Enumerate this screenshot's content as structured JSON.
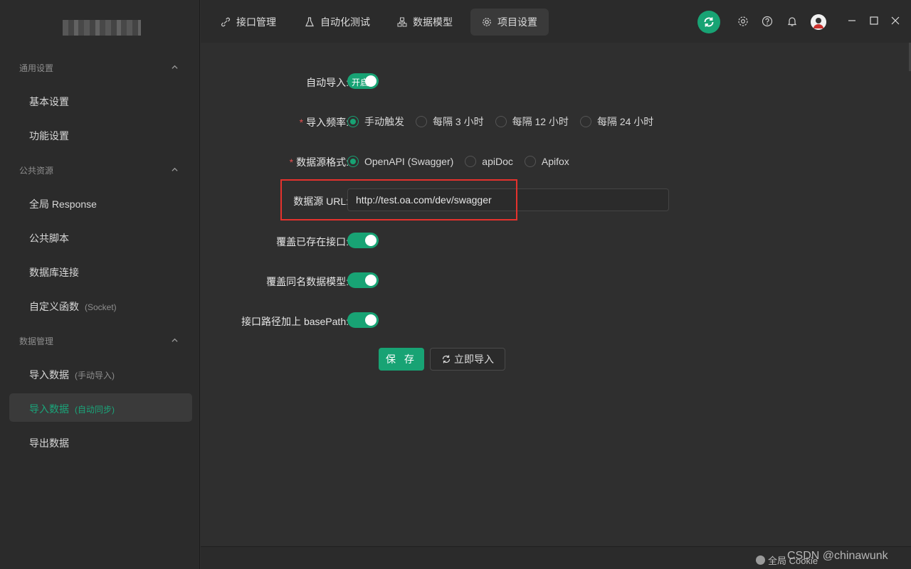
{
  "sidebar": {
    "sections": [
      {
        "title": "通用设置",
        "items": [
          {
            "label": "基本设置",
            "sub": ""
          },
          {
            "label": "功能设置",
            "sub": ""
          }
        ]
      },
      {
        "title": "公共资源",
        "items": [
          {
            "label": "全局 Response",
            "sub": ""
          },
          {
            "label": "公共脚本",
            "sub": ""
          },
          {
            "label": "数据库连接",
            "sub": ""
          },
          {
            "label": "自定义函数",
            "sub": "(Socket)"
          }
        ]
      },
      {
        "title": "数据管理",
        "items": [
          {
            "label": "导入数据",
            "sub": "(手动导入)"
          },
          {
            "label": "导入数据",
            "sub": "(自动同步)",
            "active": true
          },
          {
            "label": "导出数据",
            "sub": ""
          }
        ]
      }
    ]
  },
  "tabs": [
    {
      "label": "接口管理",
      "icon": "link-icon"
    },
    {
      "label": "自动化测试",
      "icon": "flask-icon"
    },
    {
      "label": "数据模型",
      "icon": "model-icon"
    },
    {
      "label": "项目设置",
      "icon": "gear-icon",
      "active": true
    }
  ],
  "form": {
    "auto_import": {
      "label": "自动导入:",
      "toggle_text": "开启",
      "value": true
    },
    "frequency": {
      "label": "导入频率:",
      "required": "*",
      "options": [
        "手动触发",
        "每隔 3 小时",
        "每隔 12 小时",
        "每隔 24 小时"
      ],
      "selected": "手动触发"
    },
    "source_format": {
      "label": "数据源格式:",
      "required": "*",
      "options": [
        "OpenAPI (Swagger)",
        "apiDoc",
        "Apifox"
      ],
      "selected": "OpenAPI (Swagger)"
    },
    "source_url": {
      "label": "数据源 URL:",
      "value": "http://test.oa.com/dev/swagger"
    },
    "overwrite_apis": {
      "label": "覆盖已存在接口:",
      "value": true
    },
    "overwrite_models": {
      "label": "覆盖同名数据模型:",
      "value": true
    },
    "base_path": {
      "label": "接口路径加上 basePath:",
      "value": true
    }
  },
  "actions": {
    "save": "保 存",
    "import_now": "立即导入"
  },
  "footer": {
    "cookie_text": "全局 Cookie",
    "watermark": "CSDN @chinawunk"
  },
  "colors": {
    "accent": "#18a374",
    "highlight": "#e5322d",
    "background": "#2f2f2f"
  }
}
